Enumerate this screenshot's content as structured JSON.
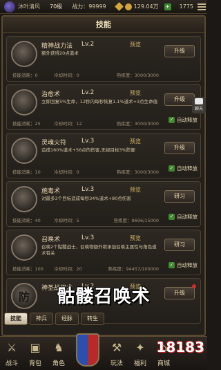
{
  "status": {
    "name": "沐叶清风",
    "level": "70级",
    "power_label": "战力：",
    "power": "99999",
    "gold": "129.04万",
    "add": "+",
    "time": "1775"
  },
  "panel": {
    "title": "技能"
  },
  "skills": [
    {
      "emblem": "",
      "name": "精神战力法",
      "level": "Lv.2",
      "preview": "预览",
      "desc": "额外获得20点道术",
      "cost": "技能消耗：0",
      "cooldown": "冷却时间：0",
      "proficiency": "熟练度：3000/3000",
      "button": "升级",
      "auto": null
    },
    {
      "emblem": "",
      "name": "治愈术",
      "level": "Lv.2",
      "preview": "预览",
      "desc": "立即回复5%生命，12秒内每秒恢复1.1%道术+3点生命值",
      "cost": "技能消耗：25",
      "cooldown": "冷却时间：12",
      "proficiency": "熟练度：3000/3000",
      "button": "升级",
      "auto": "自动释放"
    },
    {
      "emblem": "",
      "name": "灵魂火符",
      "level": "Lv.3",
      "preview": "预览",
      "desc": "造成160%道术+56点的伤害,无视目标3%防御",
      "cost": "技能消耗：10",
      "cooldown": "冷却时间：0",
      "proficiency": "熟练度：3000/3000",
      "button": "升级",
      "auto": "自动释放"
    },
    {
      "emblem": "",
      "name": "施毒术",
      "level": "Lv.3",
      "preview": "预览",
      "desc": "对最多3个目标造成每秒34%道术+80点伤害",
      "cost": "技能消耗：40",
      "cooldown": "冷却时间：5",
      "proficiency": "熟练度：8696/15000",
      "button": "研习",
      "auto": "自动释放"
    },
    {
      "emblem": "",
      "name": "召唤术",
      "level": "Lv.3",
      "preview": "预览",
      "desc": "召唤2个骷髅战士，召唤物额外继承加召唤主属性与角色道术有关",
      "cost": "技能消耗：100",
      "cooldown": "冷却时间：20",
      "proficiency": "熟练度：94457/100000",
      "button": "研习",
      "auto": "自动释放"
    },
    {
      "emblem": "防",
      "name": "神圣战甲术",
      "level": "Lv.2",
      "preview": "预览",
      "desc": "",
      "cost": "",
      "cooldown": "",
      "proficiency": "",
      "button": "升级",
      "auto": null
    }
  ],
  "chat": {
    "label": "聊天"
  },
  "caption": "骷髅召唤术",
  "tabs": [
    "技能",
    "神兵",
    "经脉",
    "转生"
  ],
  "nav": [
    "战斗",
    "背包",
    "角色",
    "玩法",
    "福利",
    "商城"
  ],
  "watermark": "18183",
  "colors": {
    "accent": "#d6b86a",
    "auto_check": "#3e8a2e",
    "red_dot": "#d32b2b"
  }
}
